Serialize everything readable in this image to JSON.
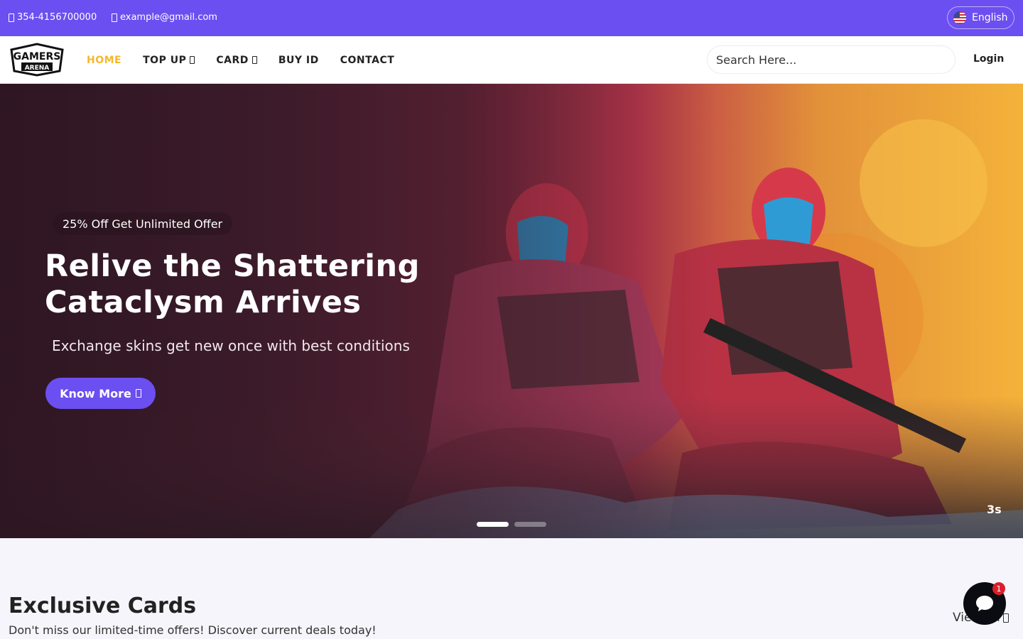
{
  "topbar": {
    "phone": "354-4156700000",
    "email": "example@gmail.com",
    "language": "English",
    "bg_color": "#6c4ff0"
  },
  "nav": {
    "logo_line1": "GAMERS",
    "logo_line2": "ARENA",
    "links": [
      {
        "label": "HOME",
        "active": true
      },
      {
        "label": "TOP UP",
        "dropdown": true
      },
      {
        "label": "CARD",
        "dropdown": true
      },
      {
        "label": "BUY ID"
      },
      {
        "label": "CONTACT"
      }
    ],
    "search_placeholder": "Search Here...",
    "login": "Login",
    "active_color": "#f5b82e"
  },
  "hero": {
    "badge": "25% Off Get Unlimited Offer",
    "title_line1": "Relive the Shattering",
    "title_line2": "Cataclysm Arrives",
    "subtitle": "Exchange skins get new once with best conditions",
    "cta": "Know More",
    "slides": 2,
    "active_slide": 1,
    "timer": "3s"
  },
  "section": {
    "title": "Exclusive Cards",
    "subtitle": "Don't miss our limited-time offers! Discover current deals today!",
    "view_all": "View All"
  },
  "chat": {
    "badge_count": "1"
  }
}
